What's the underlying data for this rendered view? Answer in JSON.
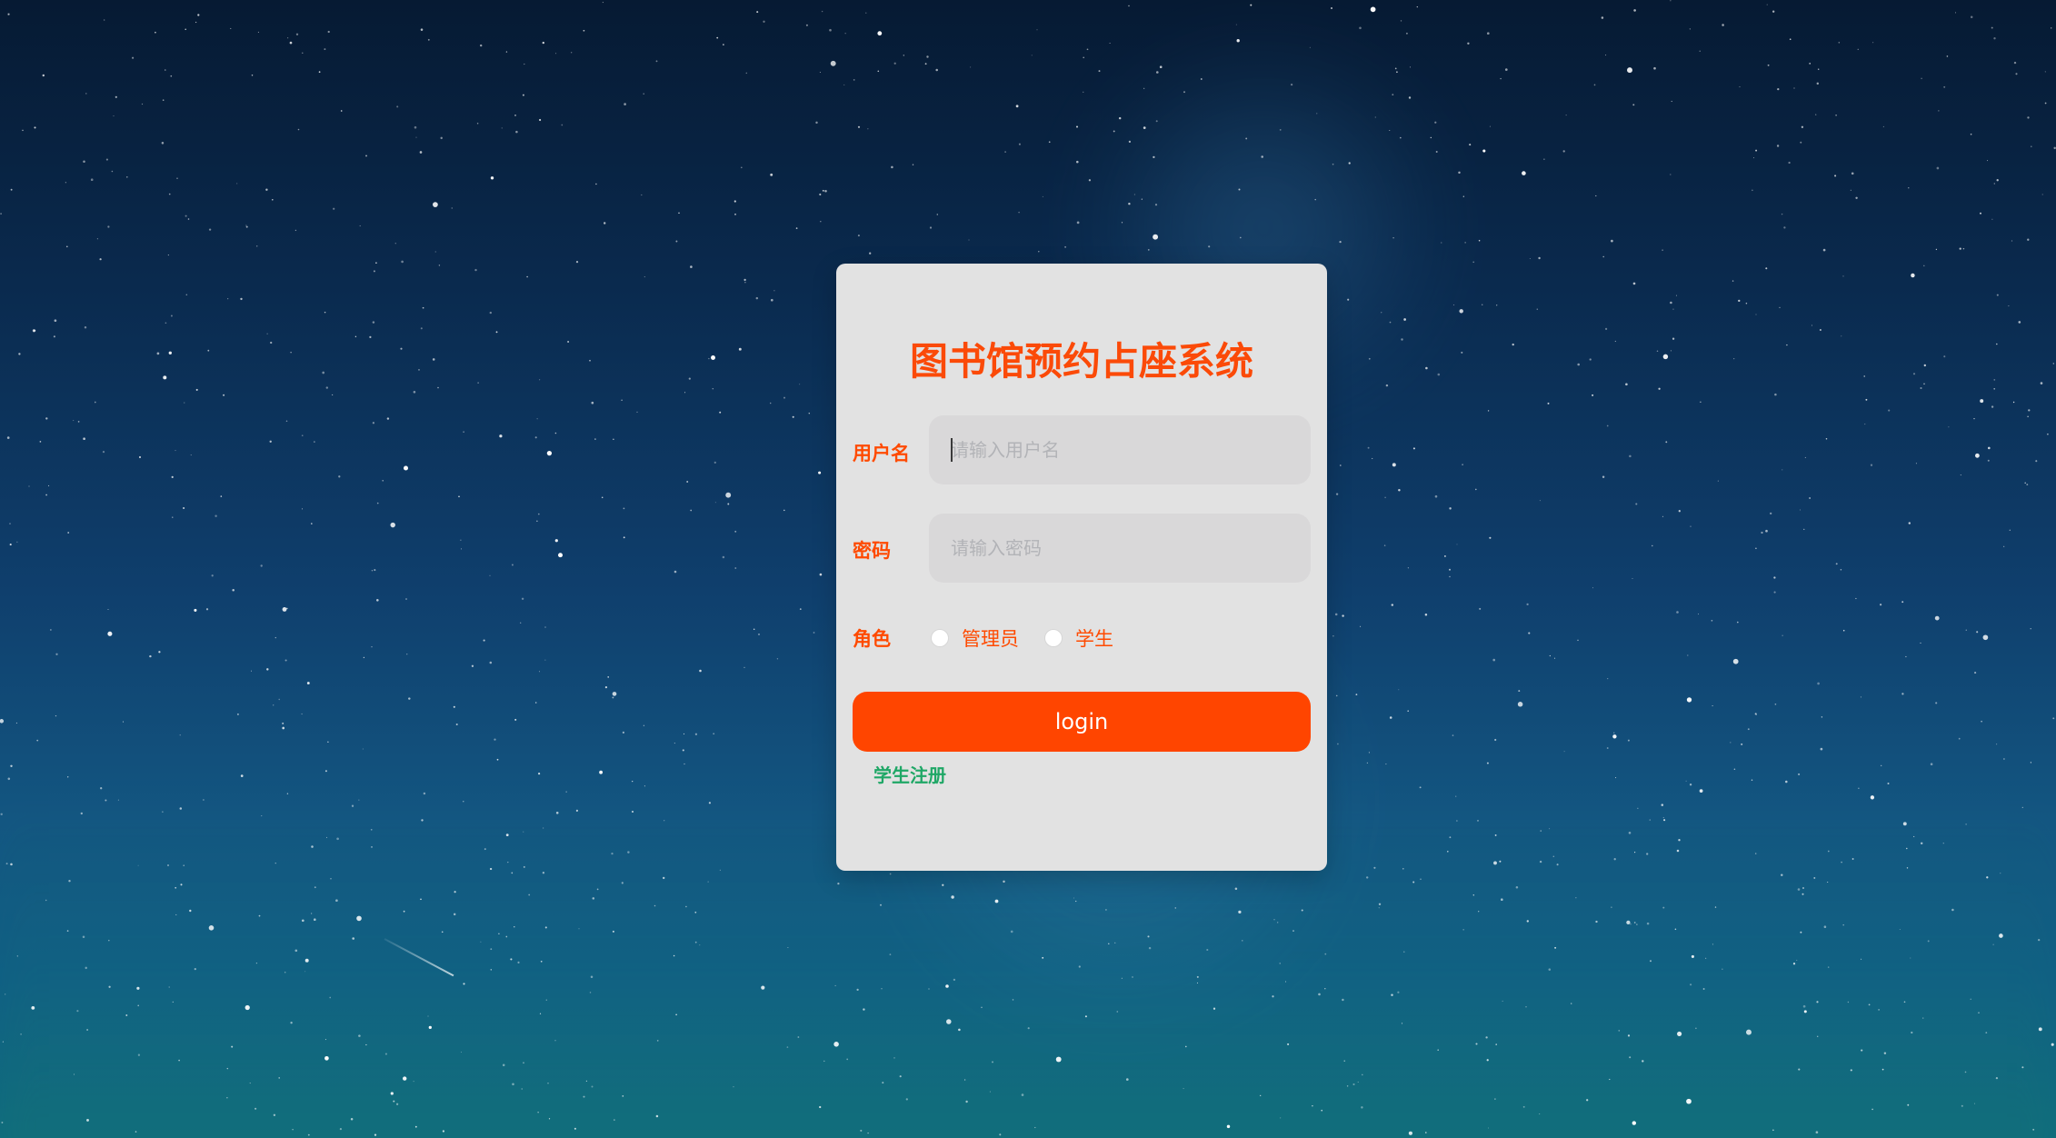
{
  "title": "图书馆预约占座系统",
  "colors": {
    "title": "#fb4a08",
    "label": "#ff4a00",
    "button": "#ff4500",
    "link": "#1fa766",
    "card": "#e2e2e2"
  },
  "form": {
    "username_label": "用户名",
    "username_placeholder": "请输入用户名",
    "password_label": "密码",
    "password_placeholder": "请输入密码",
    "role_label": "角色",
    "roles": [
      "管理员",
      "学生"
    ]
  },
  "actions": {
    "login_label": "login",
    "register_label": "学生注册"
  }
}
